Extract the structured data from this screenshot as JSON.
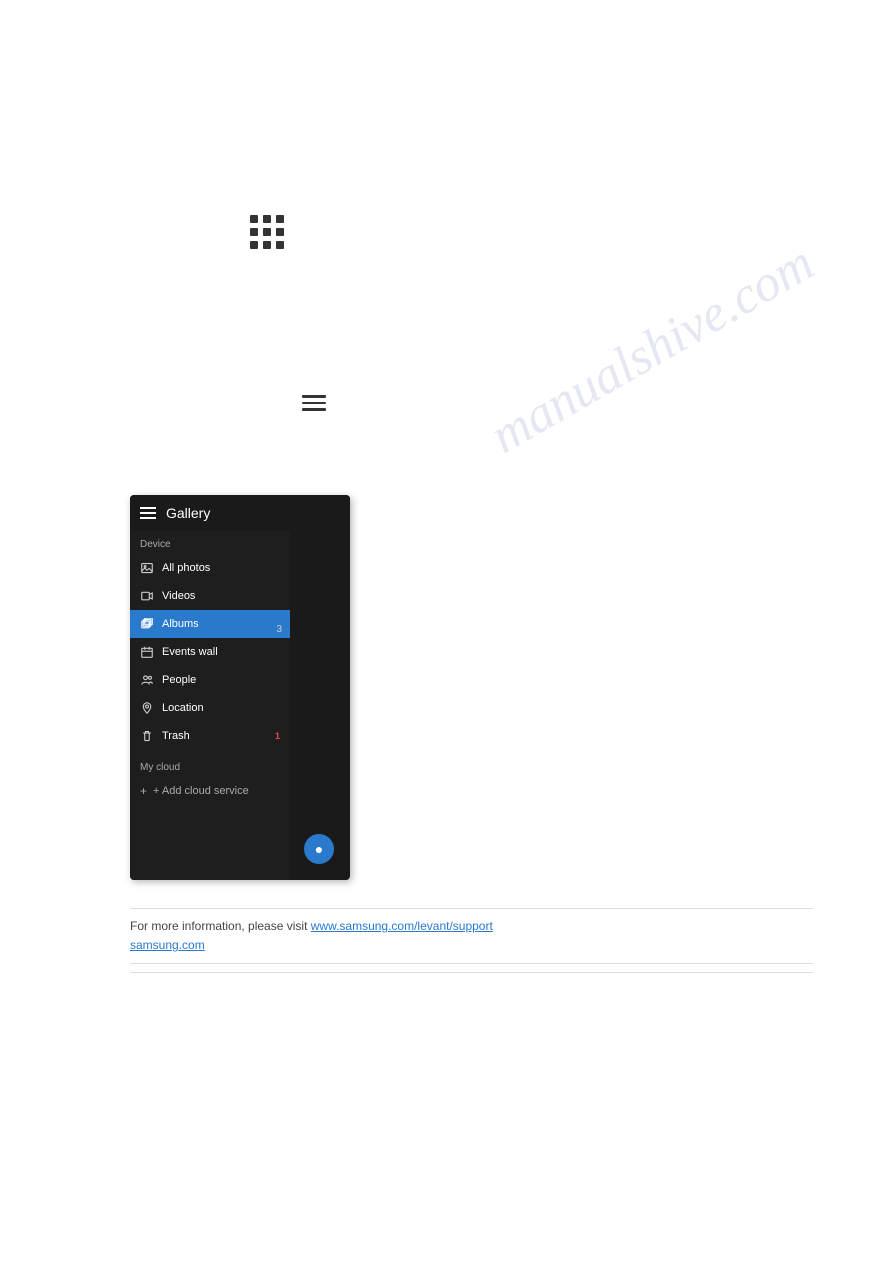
{
  "page": {
    "background": "#ffffff"
  },
  "watermark": {
    "text": "manualshive.com"
  },
  "grid_icon": {
    "label": "grid-icon"
  },
  "hamburger_icon": {
    "label": "hamburger-menu-icon"
  },
  "gallery_app": {
    "header": {
      "title": "Gallery"
    },
    "device_section_label": "Device",
    "my_cloud_section_label": "My cloud",
    "sidebar_items": [
      {
        "id": "all-photos",
        "label": "All photos",
        "icon": "image-icon",
        "active": false,
        "badge": ""
      },
      {
        "id": "videos",
        "label": "Videos",
        "icon": "video-icon",
        "active": false,
        "badge": ""
      },
      {
        "id": "albums",
        "label": "Albums",
        "icon": "albums-icon",
        "active": true,
        "badge": ""
      },
      {
        "id": "events-wall",
        "label": "Events wall",
        "icon": "events-icon",
        "active": false,
        "badge": ""
      },
      {
        "id": "people",
        "label": "People",
        "icon": "people-icon",
        "active": false,
        "badge": ""
      },
      {
        "id": "location",
        "label": "Location",
        "icon": "location-icon",
        "active": false,
        "badge": ""
      },
      {
        "id": "trash",
        "label": "Trash",
        "icon": "trash-icon",
        "active": false,
        "badge": "1"
      }
    ],
    "add_cloud_label": "+ Add cloud service",
    "right_number": "3"
  },
  "bottom_section": {
    "text1": "For more information, please visit",
    "link1": "www.samsung.com/levant/support",
    "link2": "samsung.com",
    "text2": ""
  }
}
